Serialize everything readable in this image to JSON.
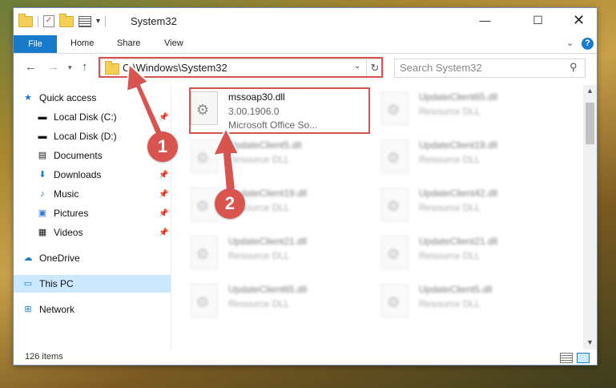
{
  "window": {
    "title": "System32",
    "min_glyph": "—",
    "max_glyph": "☐",
    "close_glyph": "✕"
  },
  "ribbon": {
    "file": "File",
    "home": "Home",
    "share": "Share",
    "view": "View",
    "help": "?"
  },
  "address": {
    "path": "C:\\Windows\\System32",
    "search_placeholder": "Search System32"
  },
  "nav_pane": {
    "quick_access": "Quick access",
    "items": [
      {
        "label": "Local Disk (C:)",
        "icon": "drive-icon",
        "pinned": true
      },
      {
        "label": "Local Disk (D:)",
        "icon": "drive-icon",
        "pinned": false
      },
      {
        "label": "Documents",
        "icon": "documents-icon",
        "pinned": true
      },
      {
        "label": "Downloads",
        "icon": "download-icon",
        "pinned": true
      },
      {
        "label": "Music",
        "icon": "music-icon",
        "pinned": true
      },
      {
        "label": "Pictures",
        "icon": "pictures-icon",
        "pinned": true
      },
      {
        "label": "Videos",
        "icon": "videos-icon",
        "pinned": true
      }
    ],
    "onedrive": "OneDrive",
    "this_pc": "This PC",
    "network": "Network"
  },
  "files": {
    "highlighted": {
      "name": "mssoap30.dll",
      "version": "3.00.1906.0",
      "desc": "Microsoft Office So..."
    },
    "blurred": [
      {
        "name": "UpdateClient65.dll",
        "desc": "Resource DLL"
      },
      {
        "name": "UpdateClient5.dll",
        "desc": "Resource DLL"
      },
      {
        "name": "UpdateClient19.dll",
        "desc": "Resource DLL"
      },
      {
        "name": "UpdateClient19.dll",
        "desc": "Resource DLL"
      },
      {
        "name": "UpdateClient42.dll",
        "desc": "Resource DLL"
      },
      {
        "name": "UpdateClient21.dll",
        "desc": "Resource DLL"
      },
      {
        "name": "UpdateClient21.dll",
        "desc": "Resource DLL"
      },
      {
        "name": "UpdateClient65.dll",
        "desc": "Resource DLL"
      },
      {
        "name": "UpdateClient5.dll",
        "desc": "Resource DLL"
      }
    ]
  },
  "status": {
    "items": "126 items"
  },
  "annotations": {
    "step1": "1",
    "step2": "2",
    "color": "#d9534f"
  }
}
